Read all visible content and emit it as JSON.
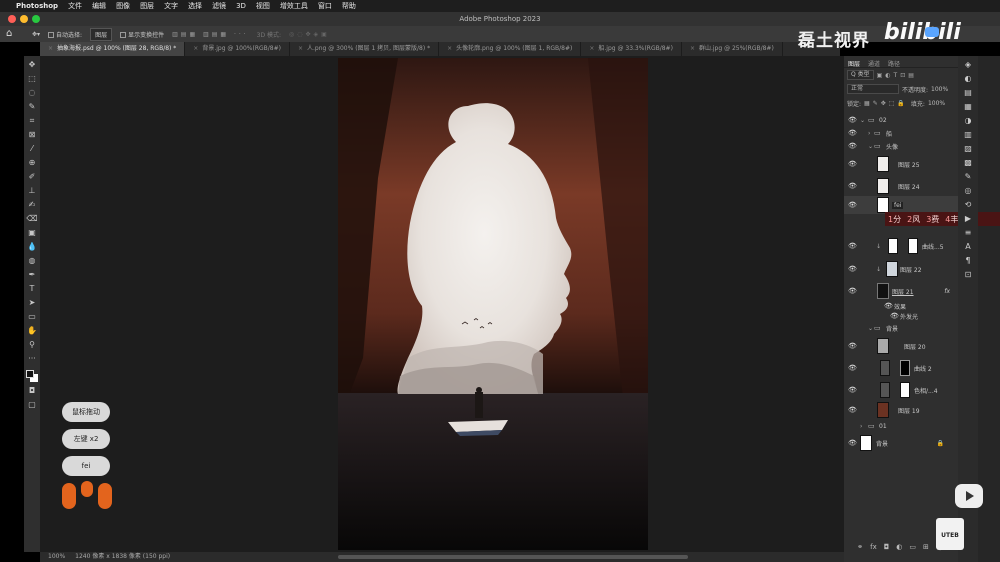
{
  "menubar": {
    "app_name": "Photoshop",
    "items": [
      "文件",
      "编辑",
      "图像",
      "图层",
      "文字",
      "选择",
      "滤镜",
      "3D",
      "视图",
      "增效工具",
      "窗口",
      "帮助"
    ]
  },
  "window": {
    "title": "Adobe Photoshop 2023"
  },
  "options_bar": {
    "auto_select_label": "自动选择:",
    "auto_select_value": "图层",
    "show_transform_label": "显示变换控件",
    "mode_3d_label": "3D 模式:"
  },
  "tabs": [
    {
      "label": "抽象海报.psd @ 100% (图层 28, RGB/8) *",
      "active": true
    },
    {
      "label": "背景.jpg @ 100%(RGB/8#)",
      "active": false
    },
    {
      "label": "人.png @ 300% (图层 1 拷贝, 图层蒙版/8) *",
      "active": false
    },
    {
      "label": "头像轮廓.png @ 100% (图层 1, RGB/8#)",
      "active": false
    },
    {
      "label": "船.jpg @ 33.3%(RGB/8#)",
      "active": false
    },
    {
      "label": "群山.jpg @ 25%(RGB/8#)",
      "active": false
    }
  ],
  "status_bar": {
    "zoom": "100%",
    "doc_info": "1240 像素 x 1838 像素 (150 ppi)"
  },
  "overlay_pills": [
    "鼠标拖动",
    "左键 x2",
    "fei"
  ],
  "watermark": {
    "channel": "磊土视界",
    "site": "bilibili",
    "badge": "UTEB"
  },
  "layers_panel": {
    "tabs": [
      "图层",
      "通道",
      "路径"
    ],
    "filter_label": "Q 类型",
    "blend_mode": "正常",
    "opacity_label": "不透明度:",
    "opacity_value": "100%",
    "lock_label": "锁定:",
    "fill_label": "填充:",
    "fill_value": "100%",
    "layers": [
      {
        "name": "02",
        "kind": "group-open"
      },
      {
        "name": "船",
        "kind": "group-closed"
      },
      {
        "name": "头像",
        "kind": "group-open"
      },
      {
        "name": "图层 25",
        "kind": "layer"
      },
      {
        "name": "图层 24",
        "kind": "layer"
      },
      {
        "name": "fei",
        "kind": "editing"
      },
      {
        "name": "曲线...5",
        "kind": "adjustment"
      },
      {
        "name": "图层 22",
        "kind": "layer"
      },
      {
        "name": "图层 21",
        "kind": "layer-fx"
      },
      {
        "name": "效果",
        "kind": "effect"
      },
      {
        "name": "外发光",
        "kind": "effect"
      },
      {
        "name": "背景",
        "kind": "group-open"
      },
      {
        "name": "图层 20",
        "kind": "layer"
      },
      {
        "name": "曲线 2",
        "kind": "adjustment"
      },
      {
        "name": "色相/...4",
        "kind": "adjustment"
      },
      {
        "name": "图层 19",
        "kind": "layer"
      },
      {
        "name": "01",
        "kind": "group-closed"
      },
      {
        "name": "背景",
        "kind": "background"
      }
    ]
  },
  "ime_candidates": [
    {
      "num": "1",
      "text": "分"
    },
    {
      "num": "2",
      "text": "风"
    },
    {
      "num": "3",
      "text": "费"
    },
    {
      "num": "4",
      "text": "丰"
    },
    {
      "num": "5",
      "text": ""
    }
  ],
  "colors": {
    "accent_orange": "#e3641d",
    "cliff": "#6b3222",
    "sky_glow": "#efebe8"
  }
}
